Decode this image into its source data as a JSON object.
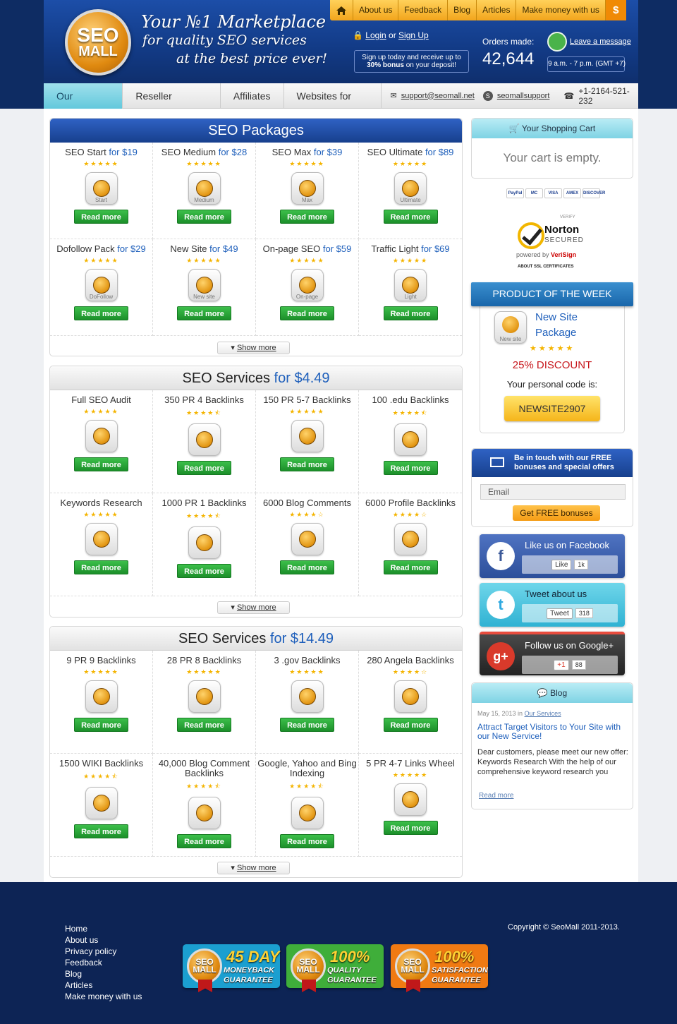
{
  "header": {
    "logo_line1": "SEO",
    "logo_line2": "MALL",
    "slogan1": "Your №1 Marketplace",
    "slogan2": "for quality SEO services",
    "slogan3": "at the best price ever!",
    "topnav": [
      "About us",
      "Feedback",
      "Blog",
      "Articles",
      "Make money with us"
    ],
    "dollar": "$",
    "login": "Login",
    "or": "or",
    "signup": "Sign Up",
    "signup_promo1": "Sign up today and receive up to",
    "signup_promo2_bold": "30% bonus",
    "signup_promo2": "on your deposit!",
    "orders_label": "Orders made:",
    "orders_count": "42,644",
    "leave_message": "Leave a message",
    "hours": "9 a.m. - 7 p.m. (GMT +7)"
  },
  "mainnav": {
    "tabs": [
      "Our Services",
      "Reseller Program",
      "Affiliates",
      "Websites for Sale"
    ],
    "email": "support@seomall.net",
    "skype": "seomallsupport",
    "phone": "+1-2164-521-232"
  },
  "packages": {
    "title": "SEO Packages",
    "items": [
      {
        "name": "SEO Start",
        "price": "for $19",
        "tag": "Start"
      },
      {
        "name": "SEO Medium",
        "price": "for $28",
        "tag": "Medium"
      },
      {
        "name": "SEO Max",
        "price": "for $39",
        "tag": "Max"
      },
      {
        "name": "SEO Ultimate",
        "price": "for $89",
        "tag": "Ultimate"
      },
      {
        "name": "Dofollow Pack",
        "price": "for $29",
        "tag": "DoFollow"
      },
      {
        "name": "New Site",
        "price": "for $49",
        "tag": "New site"
      },
      {
        "name": "On-page SEO",
        "price": "for $59",
        "tag": "On-page"
      },
      {
        "name": "Traffic Light",
        "price": "for $69",
        "tag": "Light"
      }
    ]
  },
  "services1": {
    "title": "SEO Services",
    "price": "for $4.49",
    "items": [
      {
        "name": "Full SEO Audit",
        "rating": 5
      },
      {
        "name": "350 PR 4 Backlinks",
        "rating": 4.5
      },
      {
        "name": "150 PR 5-7 Backlinks",
        "rating": 5
      },
      {
        "name": "100 .edu Backlinks",
        "rating": 4.5
      },
      {
        "name": "Keywords Research",
        "rating": 5
      },
      {
        "name": "1000 PR 1 Backlinks",
        "rating": 4.5
      },
      {
        "name": "6000 Blog Comments",
        "rating": 4
      },
      {
        "name": "6000 Profile Backlinks",
        "rating": 4
      }
    ]
  },
  "services2": {
    "title": "SEO Services",
    "price": "for $14.49",
    "items": [
      {
        "name": "9 PR 9 Backlinks",
        "rating": 5
      },
      {
        "name": "28 PR 8 Backlinks",
        "rating": 5
      },
      {
        "name": "3 .gov Backlinks",
        "rating": 5
      },
      {
        "name": "280 Angela Backlinks",
        "rating": 4
      },
      {
        "name": "1500 WIKI Backlinks",
        "rating": 4.5
      },
      {
        "name": "40,000 Blog Comment Backlinks",
        "rating": 4.5
      },
      {
        "name": "Google, Yahoo and Bing Indexing",
        "rating": 4.5
      },
      {
        "name": "5 PR 4-7 Links Wheel",
        "rating": 5
      }
    ]
  },
  "read_more": "Read more",
  "show_more": "Show more",
  "cart": {
    "title": "Your Shopping Cart",
    "empty": "Your cart is empty."
  },
  "payments": [
    "PayPal",
    "MC",
    "VISA",
    "AMEX",
    "DISCOVER"
  ],
  "norton": {
    "verify": "VERIFY",
    "name": "Norton",
    "secured": "SECURED",
    "powered": "powered by",
    "verisign": "VeriSign",
    "about": "ABOUT SSL CERTIFICATES"
  },
  "potw": {
    "title": "PRODUCT OF THE WEEK",
    "icon_tag": "New site",
    "name_line1": "New Site",
    "name_line2": "Package",
    "discount": "25% DISCOUNT",
    "code_label": "Your personal code is:",
    "code": "NEWSITE2907"
  },
  "newsletter": {
    "line1": "Be in touch with our FREE",
    "line2": "bonuses and special offers",
    "email_placeholder": "Email",
    "button": "Get FREE bonuses"
  },
  "social": {
    "facebook": {
      "title": "Like us on Facebook",
      "btn": "Like",
      "count": "1k"
    },
    "twitter": {
      "title": "Tweet about us",
      "btn": "Tweet",
      "count": "318"
    },
    "google": {
      "title": "Follow us on Google+",
      "btn": "+1",
      "count": "88"
    }
  },
  "blog": {
    "title": "Blog",
    "date": "May 15, 2013 in",
    "category": "Our Services",
    "post_title": "Attract Target Visitors to Your Site with our New Service!",
    "excerpt": "Dear customers, please meet our new offer: Keywords Research With the help of our comprehensive keyword research you",
    "read_more": "Read more"
  },
  "footer": {
    "links": [
      "Home",
      "About us",
      "Privacy policy",
      "Feedback",
      "Blog",
      "Articles",
      "Make money with us"
    ],
    "copyright": "Copyright © SeoMall 2011-2013.",
    "badges": [
      {
        "big": "45 DAY",
        "l1": "MONEYBACK",
        "l2": "GUARANTEE",
        "color": "#1b9fd0"
      },
      {
        "big": "100%",
        "l1": "QUALITY",
        "l2": "GUARANTEE",
        "color": "#3fae3a"
      },
      {
        "big": "100%",
        "l1": "SATISFACTION",
        "l2": "GUARANTEE",
        "color": "#f07a12"
      }
    ]
  }
}
